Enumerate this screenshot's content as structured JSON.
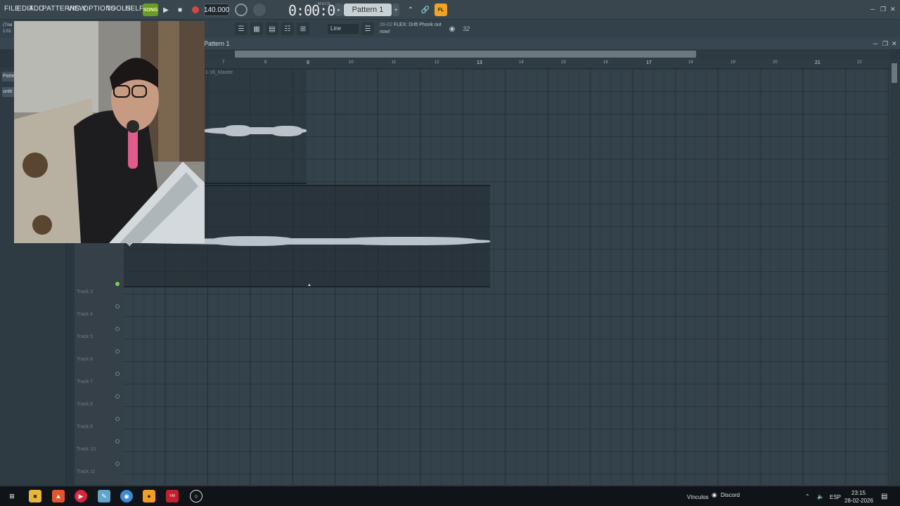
{
  "menu": {
    "items": [
      "FILE",
      "EDIT",
      "ADD",
      "PATTERNS",
      "VIEW",
      "OPTIONS",
      "TOOLS",
      "HELP"
    ]
  },
  "transport": {
    "song_mode_label": "SONG",
    "tempo": "140.000",
    "time": "0:00:00",
    "time_unit": "M:S:CS",
    "pattern_selector": "Pattern 1",
    "logo_label": "FL"
  },
  "toolbar2": {
    "snap_mode": "Line",
    "news_date": "26-02",
    "news_text": "FLEX: Drift Phonk out now!",
    "cpu_label": "32"
  },
  "left_panel": {
    "trial_text": "(Trial",
    "trial_time": "1:01",
    "tabs": [
      "Patte",
      "untit"
    ]
  },
  "playlist": {
    "title": "Pattern 1",
    "clip_master_label": "1-16_Master",
    "bar_numbers": [
      "7",
      "8",
      "9",
      "10",
      "11",
      "12",
      "13",
      "14",
      "15",
      "16",
      "17",
      "18",
      "19",
      "20",
      "21",
      "22"
    ],
    "tracks": [
      "Track 3",
      "Track 4",
      "Track 5",
      "Track 6",
      "Track 7",
      "Track 8",
      "Track 9",
      "Track 10",
      "Track 11"
    ]
  },
  "taskbar": {
    "links_label": "Vínculos",
    "discord_label": "Discord",
    "language": "ESP",
    "clock_time": "23:15",
    "clock_date": "28-02-2026"
  },
  "colors": {
    "accent_green": "#7bd24d",
    "record_red": "#d8473f",
    "fl_orange": "#f0a324",
    "playlist_bg": "#34424b"
  }
}
